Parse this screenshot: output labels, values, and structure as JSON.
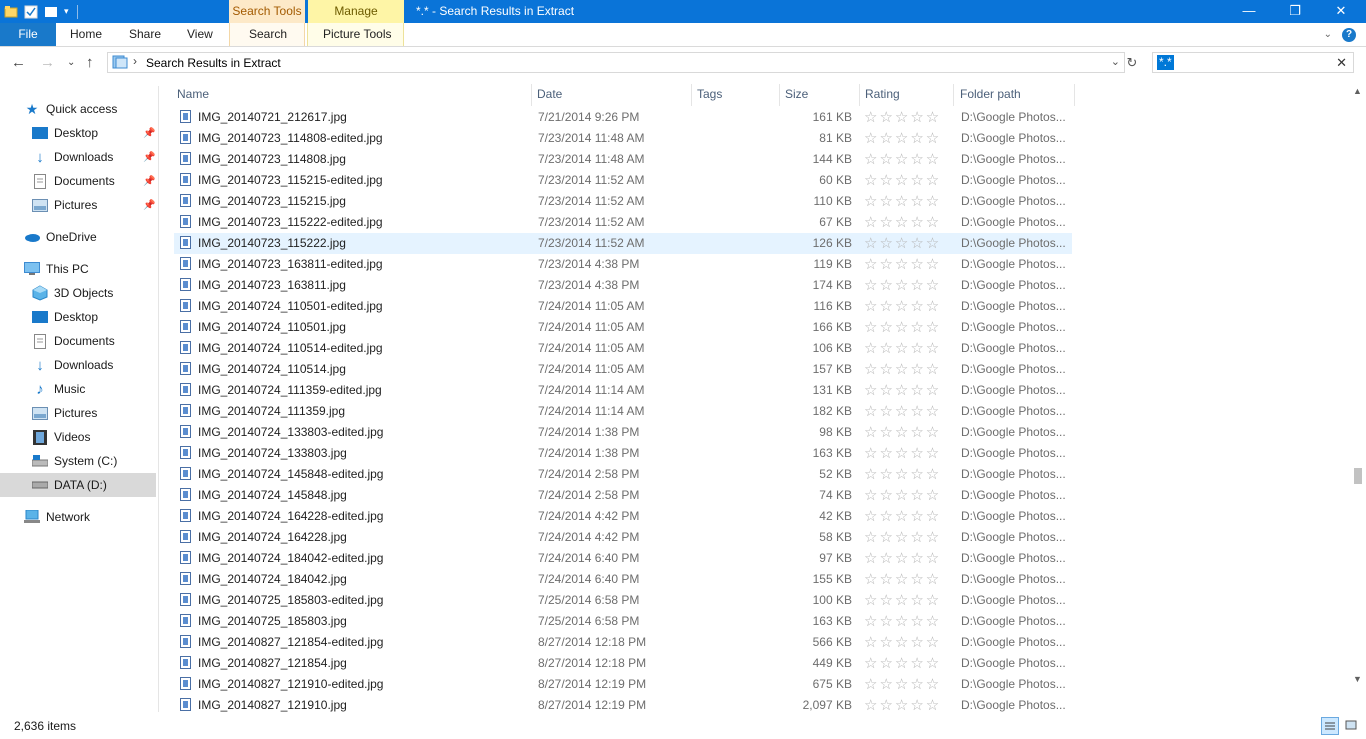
{
  "window": {
    "title": "*.* - Search Results in Extract",
    "contextual_tabs": {
      "search_tools": "Search Tools",
      "manage": "Manage"
    },
    "buttons": {
      "minimize": "—",
      "maximize": "❐",
      "close": "✕"
    }
  },
  "ribbon": {
    "tabs": [
      "File",
      "Home",
      "Share",
      "View",
      "Search",
      "Picture Tools"
    ],
    "help": "?"
  },
  "address": {
    "path": "Search Results in Extract",
    "separator": "›",
    "search_value": "*.*"
  },
  "nav": {
    "quick_access": "Quick access",
    "quick_items": [
      "Desktop",
      "Downloads",
      "Documents",
      "Pictures"
    ],
    "onedrive": "OneDrive",
    "this_pc": "This PC",
    "pc_items": [
      "3D Objects",
      "Desktop",
      "Documents",
      "Downloads",
      "Music",
      "Pictures",
      "Videos",
      "System (C:)",
      "DATA (D:)"
    ],
    "network": "Network"
  },
  "columns": {
    "name": "Name",
    "date": "Date",
    "tags": "Tags",
    "size": "Size",
    "rating": "Rating",
    "folder": "Folder path"
  },
  "files": [
    {
      "name": "IMG_20140721_212617.jpg",
      "date": "7/21/2014 9:26 PM",
      "size": "161 KB",
      "folder": "D:\\Google Photos..."
    },
    {
      "name": "IMG_20140723_114808-edited.jpg",
      "date": "7/23/2014 11:48 AM",
      "size": "81 KB",
      "folder": "D:\\Google Photos..."
    },
    {
      "name": "IMG_20140723_114808.jpg",
      "date": "7/23/2014 11:48 AM",
      "size": "144 KB",
      "folder": "D:\\Google Photos..."
    },
    {
      "name": "IMG_20140723_115215-edited.jpg",
      "date": "7/23/2014 11:52 AM",
      "size": "60 KB",
      "folder": "D:\\Google Photos..."
    },
    {
      "name": "IMG_20140723_115215.jpg",
      "date": "7/23/2014 11:52 AM",
      "size": "110 KB",
      "folder": "D:\\Google Photos..."
    },
    {
      "name": "IMG_20140723_115222-edited.jpg",
      "date": "7/23/2014 11:52 AM",
      "size": "67 KB",
      "folder": "D:\\Google Photos..."
    },
    {
      "name": "IMG_20140723_115222.jpg",
      "date": "7/23/2014 11:52 AM",
      "size": "126 KB",
      "folder": "D:\\Google Photos..."
    },
    {
      "name": "IMG_20140723_163811-edited.jpg",
      "date": "7/23/2014 4:38 PM",
      "size": "119 KB",
      "folder": "D:\\Google Photos..."
    },
    {
      "name": "IMG_20140723_163811.jpg",
      "date": "7/23/2014 4:38 PM",
      "size": "174 KB",
      "folder": "D:\\Google Photos..."
    },
    {
      "name": "IMG_20140724_110501-edited.jpg",
      "date": "7/24/2014 11:05 AM",
      "size": "116 KB",
      "folder": "D:\\Google Photos..."
    },
    {
      "name": "IMG_20140724_110501.jpg",
      "date": "7/24/2014 11:05 AM",
      "size": "166 KB",
      "folder": "D:\\Google Photos..."
    },
    {
      "name": "IMG_20140724_110514-edited.jpg",
      "date": "7/24/2014 11:05 AM",
      "size": "106 KB",
      "folder": "D:\\Google Photos..."
    },
    {
      "name": "IMG_20140724_110514.jpg",
      "date": "7/24/2014 11:05 AM",
      "size": "157 KB",
      "folder": "D:\\Google Photos..."
    },
    {
      "name": "IMG_20140724_111359-edited.jpg",
      "date": "7/24/2014 11:14 AM",
      "size": "131 KB",
      "folder": "D:\\Google Photos..."
    },
    {
      "name": "IMG_20140724_111359.jpg",
      "date": "7/24/2014 11:14 AM",
      "size": "182 KB",
      "folder": "D:\\Google Photos..."
    },
    {
      "name": "IMG_20140724_133803-edited.jpg",
      "date": "7/24/2014 1:38 PM",
      "size": "98 KB",
      "folder": "D:\\Google Photos..."
    },
    {
      "name": "IMG_20140724_133803.jpg",
      "date": "7/24/2014 1:38 PM",
      "size": "163 KB",
      "folder": "D:\\Google Photos..."
    },
    {
      "name": "IMG_20140724_145848-edited.jpg",
      "date": "7/24/2014 2:58 PM",
      "size": "52 KB",
      "folder": "D:\\Google Photos..."
    },
    {
      "name": "IMG_20140724_145848.jpg",
      "date": "7/24/2014 2:58 PM",
      "size": "74 KB",
      "folder": "D:\\Google Photos..."
    },
    {
      "name": "IMG_20140724_164228-edited.jpg",
      "date": "7/24/2014 4:42 PM",
      "size": "42 KB",
      "folder": "D:\\Google Photos..."
    },
    {
      "name": "IMG_20140724_164228.jpg",
      "date": "7/24/2014 4:42 PM",
      "size": "58 KB",
      "folder": "D:\\Google Photos..."
    },
    {
      "name": "IMG_20140724_184042-edited.jpg",
      "date": "7/24/2014 6:40 PM",
      "size": "97 KB",
      "folder": "D:\\Google Photos..."
    },
    {
      "name": "IMG_20140724_184042.jpg",
      "date": "7/24/2014 6:40 PM",
      "size": "155 KB",
      "folder": "D:\\Google Photos..."
    },
    {
      "name": "IMG_20140725_185803-edited.jpg",
      "date": "7/25/2014 6:58 PM",
      "size": "100 KB",
      "folder": "D:\\Google Photos..."
    },
    {
      "name": "IMG_20140725_185803.jpg",
      "date": "7/25/2014 6:58 PM",
      "size": "163 KB",
      "folder": "D:\\Google Photos..."
    },
    {
      "name": "IMG_20140827_121854-edited.jpg",
      "date": "8/27/2014 12:18 PM",
      "size": "566 KB",
      "folder": "D:\\Google Photos..."
    },
    {
      "name": "IMG_20140827_121854.jpg",
      "date": "8/27/2014 12:18 PM",
      "size": "449 KB",
      "folder": "D:\\Google Photos..."
    },
    {
      "name": "IMG_20140827_121910-edited.jpg",
      "date": "8/27/2014 12:19 PM",
      "size": "675 KB",
      "folder": "D:\\Google Photos..."
    },
    {
      "name": "IMG_20140827_121910.jpg",
      "date": "8/27/2014 12:19 PM",
      "size": "2,097 KB",
      "folder": "D:\\Google Photos..."
    }
  ],
  "highlighted_row": 6,
  "rating_stars": "☆☆☆☆☆",
  "status": {
    "item_count": "2,636 items"
  },
  "colors": {
    "titlebar": "#0a74d8",
    "file_tab": "#1979ca",
    "hover_row": "#e5f3ff",
    "selected_nav": "#d9d9d9"
  }
}
